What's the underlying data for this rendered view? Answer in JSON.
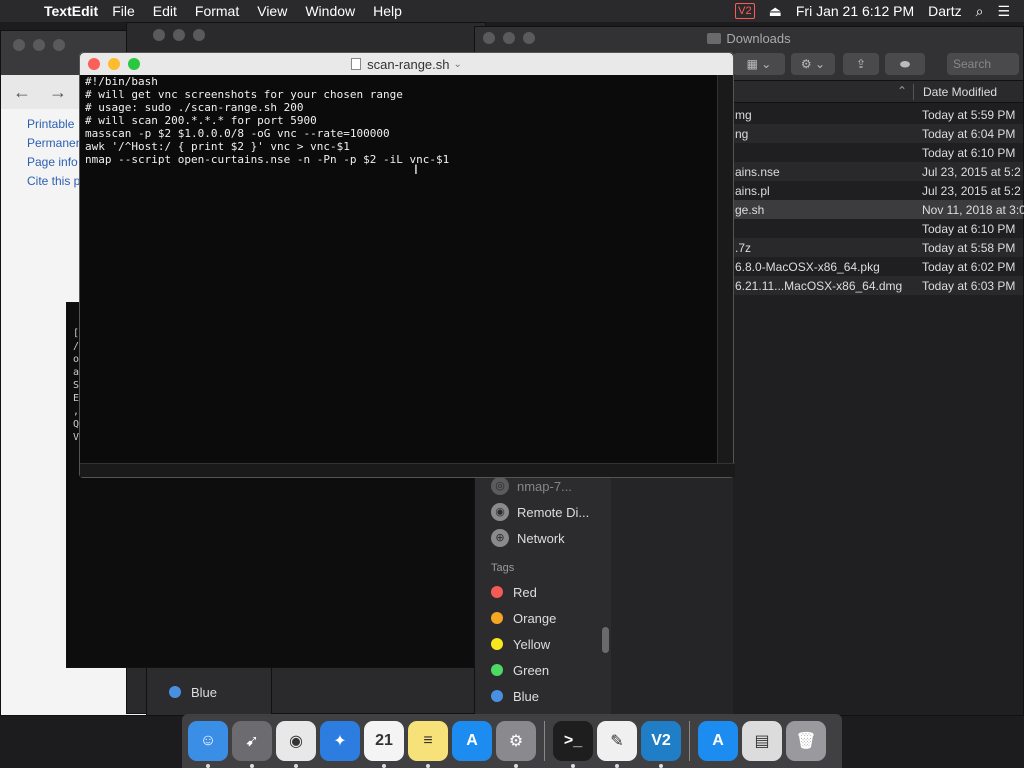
{
  "menubar": {
    "app": "TextEdit",
    "menus": [
      "File",
      "Edit",
      "Format",
      "View",
      "Window",
      "Help"
    ],
    "vnc_status": "V2",
    "datetime": "Fri Jan 21  6:12 PM",
    "user": "Dartz"
  },
  "browser": {
    "links": [
      "Printable",
      "Permanen",
      "Page info",
      "Cite this p"
    ]
  },
  "textedit": {
    "title": "scan-range.sh",
    "content": "#!/bin/bash\n# will get vnc screenshots for your chosen range\n# usage: sudo ./scan-range.sh 200\n# will scan 200.*.*.* for port 5900\nmasscan -p $2 $1.0.0.0/8 -oG vnc --rate=100000\nawk '/^Host:/ { print $2 }' vnc > vnc-$1\nnmap --script open-curtains.nse -n -Pn -p $2 -iL vnc-$1"
  },
  "back_terminal": {
    "lines": [
      "[V",
      "/",
      "o",
      "a",
      "",
      "S",
      "E",
      ",",
      "Q",
      "V"
    ]
  },
  "finder": {
    "title": "Downloads",
    "search_placeholder": "Search",
    "date_column": "Date Modified",
    "files": [
      {
        "name": "mg",
        "date": "Today at 5:59 PM"
      },
      {
        "name": "ng",
        "date": "Today at 6:04 PM"
      },
      {
        "name": "",
        "date": "Today at 6:10 PM"
      },
      {
        "name": "ains.nse",
        "date": "Jul 23, 2015 at 5:2"
      },
      {
        "name": "ains.pl",
        "date": "Jul 23, 2015 at 5:2"
      },
      {
        "name": "ge.sh",
        "date": "Nov 11, 2018 at 3:0"
      },
      {
        "name": "",
        "date": "Today at 6:10 PM"
      },
      {
        "name": ".7z",
        "date": "Today at 5:58 PM"
      },
      {
        "name": "6.8.0-MacOSX-x86_64.pkg",
        "date": "Today at 6:02 PM"
      },
      {
        "name": "6.21.11...MacOSX-x86_64.dmg",
        "date": "Today at 6:03 PM"
      }
    ],
    "sidebar": {
      "locations": [
        "nmap-7...",
        "Remote Di...",
        "Network"
      ],
      "tags_header": "Tags",
      "tags": [
        {
          "label": "Red",
          "color": "#f25c54"
        },
        {
          "label": "Orange",
          "color": "#f5a623"
        },
        {
          "label": "Yellow",
          "color": "#f8e71c"
        },
        {
          "label": "Green",
          "color": "#4cd964"
        },
        {
          "label": "Blue",
          "color": "#4a90e2"
        }
      ]
    }
  },
  "mid_sidebar": {
    "tags": [
      {
        "label": "Blue",
        "color": "#4a90e2"
      }
    ]
  },
  "dock": {
    "apps": [
      {
        "name": "finder",
        "color": "#3a8ee6",
        "glyph": "☺"
      },
      {
        "name": "launchpad",
        "color": "#6b6b70",
        "glyph": "➹"
      },
      {
        "name": "chrome",
        "color": "#e8e8e8",
        "glyph": "◉"
      },
      {
        "name": "safari",
        "color": "#2d7de0",
        "glyph": "✦"
      },
      {
        "name": "calendar",
        "color": "#f4f4f4",
        "glyph": "21"
      },
      {
        "name": "notes",
        "color": "#f7e27a",
        "glyph": "≡"
      },
      {
        "name": "app-store",
        "color": "#1d8cf0",
        "glyph": "A"
      },
      {
        "name": "system-preferences",
        "color": "#8a8a8e",
        "glyph": "⚙"
      },
      {
        "name": "terminal",
        "color": "#1e1e1e",
        "glyph": ">_"
      },
      {
        "name": "textedit",
        "color": "#f0f0f0",
        "glyph": "✎"
      },
      {
        "name": "vnc-viewer",
        "color": "#1f7ec6",
        "glyph": "V2"
      },
      {
        "name": "app-store-2",
        "color": "#1d8cf0",
        "glyph": "A"
      },
      {
        "name": "preview",
        "color": "#dcdcdc",
        "glyph": "▤"
      },
      {
        "name": "trash",
        "color": "#9a9a9e",
        "glyph": "🗑"
      }
    ]
  }
}
